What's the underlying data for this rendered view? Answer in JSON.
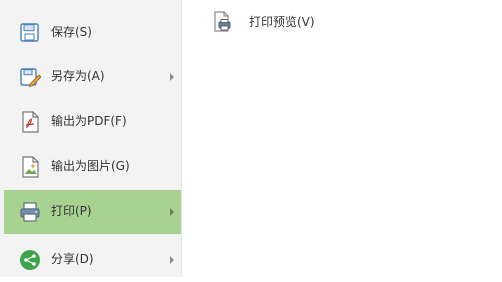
{
  "file_menu": {
    "items": [
      {
        "label": "保存(S)",
        "icon": "save-icon",
        "has_submenu": false
      },
      {
        "label": "另存为(A)",
        "icon": "save-as-icon",
        "has_submenu": true
      },
      {
        "label": "输出为PDF(F)",
        "icon": "export-pdf-icon",
        "has_submenu": false
      },
      {
        "label": "输出为图片(G)",
        "icon": "export-image-icon",
        "has_submenu": false
      },
      {
        "label": "打印(P)",
        "icon": "printer-icon",
        "has_submenu": true,
        "selected": true
      },
      {
        "label": "分享(D)",
        "icon": "share-icon",
        "has_submenu": true
      }
    ]
  },
  "print_submenu": {
    "items": [
      {
        "label": "打印预览(V)",
        "icon": "print-preview-icon"
      }
    ]
  },
  "colors": {
    "menu_background": "#f3f3f3",
    "selected_background": "#a8d28f",
    "share_green": "#3fa34d",
    "icon_blue": "#4a7fb5"
  }
}
